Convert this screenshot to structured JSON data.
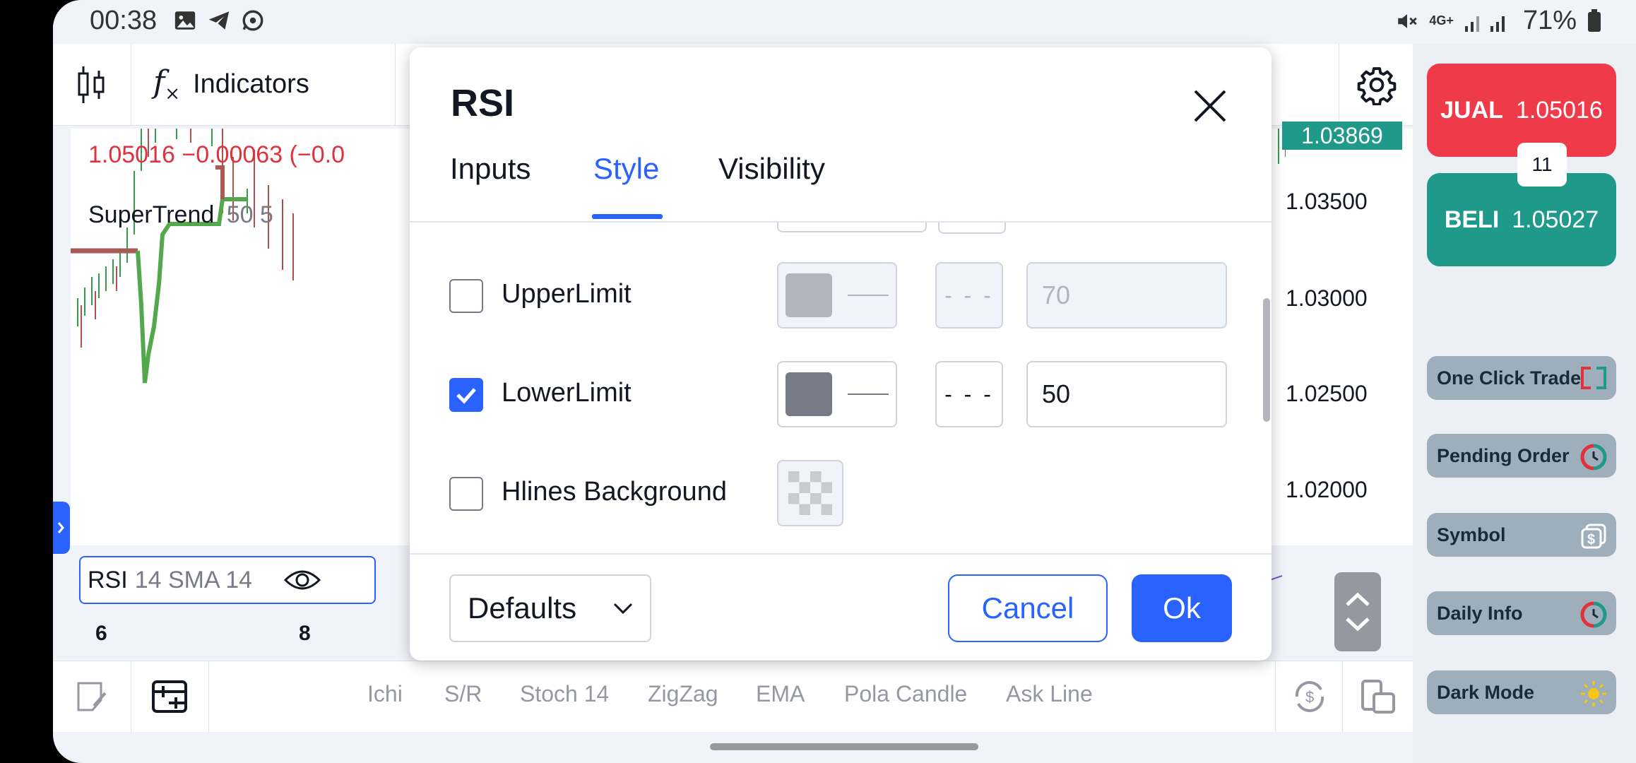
{
  "status_bar": {
    "time": "00:38",
    "network": "4G+",
    "battery": "71%"
  },
  "toolbar": {
    "indicators_label": "Indicators"
  },
  "chart": {
    "legend_price": "1.05016  −0.00063 (−0.0",
    "legend_indicator": "SuperTrend",
    "legend_indicator_params": "50 5",
    "price_tag": "1.03869",
    "price_labels": [
      "1.03500",
      "1.03000",
      "1.02500",
      "1.02000"
    ],
    "time_labels": [
      "6",
      "8"
    ],
    "rsi_name": "RSI",
    "rsi_params": "14 SMA 14",
    "colors": {
      "down": "#b0524b",
      "up": "#2fa14a",
      "supertrend_up": "#52a84a",
      "supertrend_down": "#a85a55"
    }
  },
  "dialog": {
    "title": "RSI",
    "tabs": [
      {
        "label": "Inputs",
        "active": false
      },
      {
        "label": "Style",
        "active": true
      },
      {
        "label": "Visibility",
        "active": false
      }
    ],
    "rows": [
      {
        "label": "UpperLimit",
        "checked": false,
        "color": "#b2b5be",
        "dash": "- - -",
        "value": "70"
      },
      {
        "label": "LowerLimit",
        "checked": true,
        "color": "#787b86",
        "dash": "- - -",
        "value": "50"
      },
      {
        "label": "Hlines Background",
        "checked": false
      }
    ],
    "defaults_label": "Defaults",
    "cancel_label": "Cancel",
    "ok_label": "Ok",
    "accent": "#2962ff"
  },
  "bottom_bar": {
    "quick_indicators": [
      "Ichi",
      "S/R",
      "Stoch 14",
      "ZigZag",
      "EMA",
      "Pola Candle",
      "Ask Line"
    ]
  },
  "side_panel": {
    "sell": {
      "label": "JUAL",
      "price": "1.05016",
      "color": "#ef3a4a"
    },
    "buy": {
      "label": "BELI",
      "price": "1.05027",
      "color": "#1f9a8a"
    },
    "lot": "11",
    "items": [
      {
        "label": "One Click Trade",
        "icon": "one-click-icon"
      },
      {
        "label": "Pending Order",
        "icon": "pending-icon"
      },
      {
        "label": "Symbol",
        "icon": "symbol-icon"
      },
      {
        "label": "Daily Info",
        "icon": "daily-info-icon"
      },
      {
        "label": "Dark Mode",
        "icon": "sun-icon"
      }
    ]
  }
}
